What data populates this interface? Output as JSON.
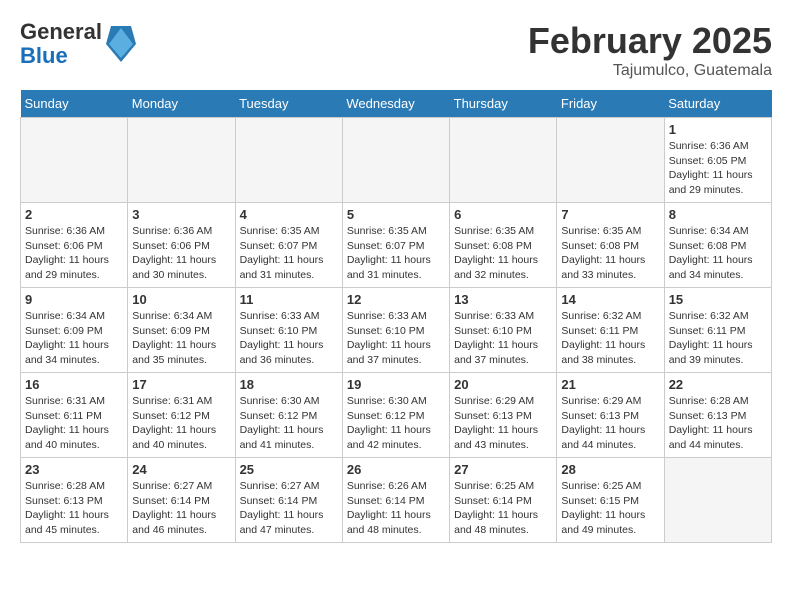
{
  "header": {
    "logo_line1": "General",
    "logo_line2": "Blue",
    "month_year": "February 2025",
    "location": "Tajumulco, Guatemala"
  },
  "weekdays": [
    "Sunday",
    "Monday",
    "Tuesday",
    "Wednesday",
    "Thursday",
    "Friday",
    "Saturday"
  ],
  "weeks": [
    [
      {
        "day": "",
        "info": ""
      },
      {
        "day": "",
        "info": ""
      },
      {
        "day": "",
        "info": ""
      },
      {
        "day": "",
        "info": ""
      },
      {
        "day": "",
        "info": ""
      },
      {
        "day": "",
        "info": ""
      },
      {
        "day": "1",
        "info": "Sunrise: 6:36 AM\nSunset: 6:05 PM\nDaylight: 11 hours\nand 29 minutes."
      }
    ],
    [
      {
        "day": "2",
        "info": "Sunrise: 6:36 AM\nSunset: 6:06 PM\nDaylight: 11 hours\nand 29 minutes."
      },
      {
        "day": "3",
        "info": "Sunrise: 6:36 AM\nSunset: 6:06 PM\nDaylight: 11 hours\nand 30 minutes."
      },
      {
        "day": "4",
        "info": "Sunrise: 6:35 AM\nSunset: 6:07 PM\nDaylight: 11 hours\nand 31 minutes."
      },
      {
        "day": "5",
        "info": "Sunrise: 6:35 AM\nSunset: 6:07 PM\nDaylight: 11 hours\nand 31 minutes."
      },
      {
        "day": "6",
        "info": "Sunrise: 6:35 AM\nSunset: 6:08 PM\nDaylight: 11 hours\nand 32 minutes."
      },
      {
        "day": "7",
        "info": "Sunrise: 6:35 AM\nSunset: 6:08 PM\nDaylight: 11 hours\nand 33 minutes."
      },
      {
        "day": "8",
        "info": "Sunrise: 6:34 AM\nSunset: 6:08 PM\nDaylight: 11 hours\nand 34 minutes."
      }
    ],
    [
      {
        "day": "9",
        "info": "Sunrise: 6:34 AM\nSunset: 6:09 PM\nDaylight: 11 hours\nand 34 minutes."
      },
      {
        "day": "10",
        "info": "Sunrise: 6:34 AM\nSunset: 6:09 PM\nDaylight: 11 hours\nand 35 minutes."
      },
      {
        "day": "11",
        "info": "Sunrise: 6:33 AM\nSunset: 6:10 PM\nDaylight: 11 hours\nand 36 minutes."
      },
      {
        "day": "12",
        "info": "Sunrise: 6:33 AM\nSunset: 6:10 PM\nDaylight: 11 hours\nand 37 minutes."
      },
      {
        "day": "13",
        "info": "Sunrise: 6:33 AM\nSunset: 6:10 PM\nDaylight: 11 hours\nand 37 minutes."
      },
      {
        "day": "14",
        "info": "Sunrise: 6:32 AM\nSunset: 6:11 PM\nDaylight: 11 hours\nand 38 minutes."
      },
      {
        "day": "15",
        "info": "Sunrise: 6:32 AM\nSunset: 6:11 PM\nDaylight: 11 hours\nand 39 minutes."
      }
    ],
    [
      {
        "day": "16",
        "info": "Sunrise: 6:31 AM\nSunset: 6:11 PM\nDaylight: 11 hours\nand 40 minutes."
      },
      {
        "day": "17",
        "info": "Sunrise: 6:31 AM\nSunset: 6:12 PM\nDaylight: 11 hours\nand 40 minutes."
      },
      {
        "day": "18",
        "info": "Sunrise: 6:30 AM\nSunset: 6:12 PM\nDaylight: 11 hours\nand 41 minutes."
      },
      {
        "day": "19",
        "info": "Sunrise: 6:30 AM\nSunset: 6:12 PM\nDaylight: 11 hours\nand 42 minutes."
      },
      {
        "day": "20",
        "info": "Sunrise: 6:29 AM\nSunset: 6:13 PM\nDaylight: 11 hours\nand 43 minutes."
      },
      {
        "day": "21",
        "info": "Sunrise: 6:29 AM\nSunset: 6:13 PM\nDaylight: 11 hours\nand 44 minutes."
      },
      {
        "day": "22",
        "info": "Sunrise: 6:28 AM\nSunset: 6:13 PM\nDaylight: 11 hours\nand 44 minutes."
      }
    ],
    [
      {
        "day": "23",
        "info": "Sunrise: 6:28 AM\nSunset: 6:13 PM\nDaylight: 11 hours\nand 45 minutes."
      },
      {
        "day": "24",
        "info": "Sunrise: 6:27 AM\nSunset: 6:14 PM\nDaylight: 11 hours\nand 46 minutes."
      },
      {
        "day": "25",
        "info": "Sunrise: 6:27 AM\nSunset: 6:14 PM\nDaylight: 11 hours\nand 47 minutes."
      },
      {
        "day": "26",
        "info": "Sunrise: 6:26 AM\nSunset: 6:14 PM\nDaylight: 11 hours\nand 48 minutes."
      },
      {
        "day": "27",
        "info": "Sunrise: 6:25 AM\nSunset: 6:14 PM\nDaylight: 11 hours\nand 48 minutes."
      },
      {
        "day": "28",
        "info": "Sunrise: 6:25 AM\nSunset: 6:15 PM\nDaylight: 11 hours\nand 49 minutes."
      },
      {
        "day": "",
        "info": ""
      }
    ]
  ]
}
